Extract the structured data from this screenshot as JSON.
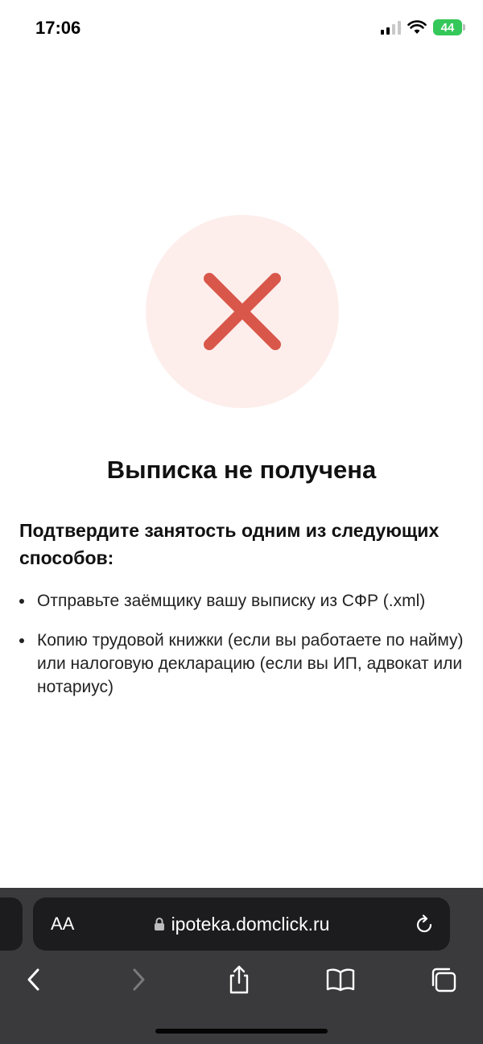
{
  "status_bar": {
    "time": "17:06",
    "battery_level": "44",
    "icons": [
      "cellular-signal-icon",
      "wifi-icon",
      "battery-icon"
    ]
  },
  "error": {
    "icon": "close-icon",
    "icon_color": "#d9574a",
    "circle_color": "#fdeeec",
    "title": "Выписка не получена"
  },
  "instructions": {
    "heading": "Подтвердите занятость одним из следующих способов:",
    "items": [
      "Отправьте заёмщику вашу выписку из СФР (.xml)",
      "Копию трудовой книжки (если вы работаете по найму) или налоговую декларацию (если вы ИП, адвокат или нотариус)"
    ]
  },
  "browser": {
    "text_size_label": "AA",
    "url": "ipoteka.domclick.ru",
    "toolbar_icons": [
      "back-icon",
      "forward-icon",
      "share-icon",
      "bookmarks-icon",
      "tabs-icon"
    ]
  }
}
